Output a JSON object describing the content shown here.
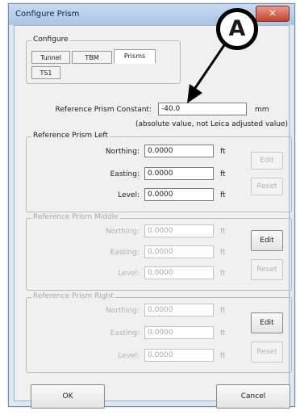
{
  "window": {
    "title": "Configure Prism",
    "close_glyph": "✕"
  },
  "callout": {
    "label": "A"
  },
  "configure": {
    "group_label": "Configure",
    "tabs": [
      {
        "label": "Tunnel"
      },
      {
        "label": "TBM"
      },
      {
        "label": "Prisms"
      },
      {
        "label": "TS1"
      }
    ]
  },
  "reference_constant": {
    "label": "Reference Prism Constant:",
    "value": "-40.0",
    "unit": "mm",
    "note": "(absolute value, not Leica adjusted value)"
  },
  "prism_left": {
    "group_label": "Reference Prism Left",
    "northing_label": "Northing:",
    "northing_value": "0.0000",
    "easting_label": "Easting:",
    "easting_value": "0.0000",
    "level_label": "Level:",
    "level_value": "0.0000",
    "unit": "ft",
    "edit_label": "Edit",
    "reset_label": "Reset"
  },
  "prism_middle": {
    "group_label": "Reference Prism Middle",
    "northing_label": "Northing:",
    "northing_value": "0.0000",
    "easting_label": "Easting:",
    "easting_value": "0.0000",
    "level_label": "Level:",
    "level_value": "0.0000",
    "unit": "ft",
    "edit_label": "Edit",
    "reset_label": "Reset"
  },
  "prism_right": {
    "group_label": "Reference Prism Right",
    "northing_label": "Northing:",
    "northing_value": "0.0000",
    "easting_label": "Easting:",
    "easting_value": "0.0000",
    "level_label": "Level:",
    "level_value": "0.0000",
    "unit": "ft",
    "edit_label": "Edit",
    "reset_label": "Reset"
  },
  "footer": {
    "ok_label": "OK",
    "cancel_label": "Cancel"
  }
}
